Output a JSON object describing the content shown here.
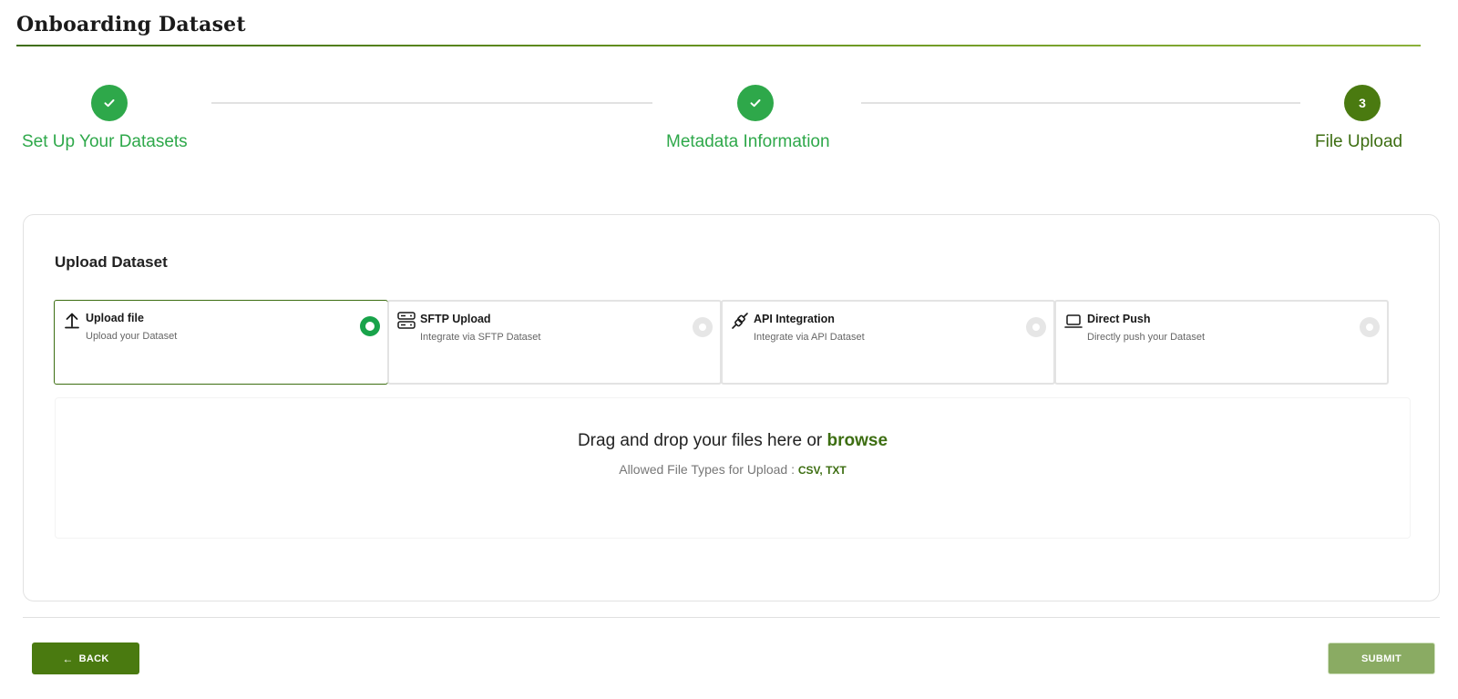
{
  "page": {
    "title": "Onboarding Dataset"
  },
  "stepper": {
    "steps": [
      {
        "label": "Set Up Your Datasets",
        "status": "done",
        "marker": "check-icon"
      },
      {
        "label": "Metadata Information",
        "status": "done",
        "marker": "check-icon"
      },
      {
        "label": "File Upload",
        "status": "active",
        "number": "3"
      }
    ]
  },
  "upload": {
    "title": "Upload Dataset",
    "options": [
      {
        "title": "Upload file",
        "desc": "Upload your Dataset",
        "icon": "upload-icon",
        "selected": true
      },
      {
        "title": "SFTP Upload",
        "desc": "Integrate via SFTP Dataset",
        "icon": "server-icon",
        "selected": false
      },
      {
        "title": "API Integration",
        "desc": "Integrate via API Dataset",
        "icon": "plug-icon",
        "selected": false
      },
      {
        "title": "Direct Push",
        "desc": "Directly push your Dataset",
        "icon": "laptop-icon",
        "selected": false
      }
    ],
    "dropzone": {
      "text": "Drag and drop your files here or",
      "browse": "browse",
      "allowed_label": "Allowed File Types for Upload :",
      "allowed_types": "CSV, TXT"
    }
  },
  "footer": {
    "back_label": "BACK",
    "submit_label": "SUBMIT"
  },
  "colors": {
    "primary": "#4a7a10",
    "success": "#2ea84a",
    "submit_disabled": "#8aab63"
  }
}
